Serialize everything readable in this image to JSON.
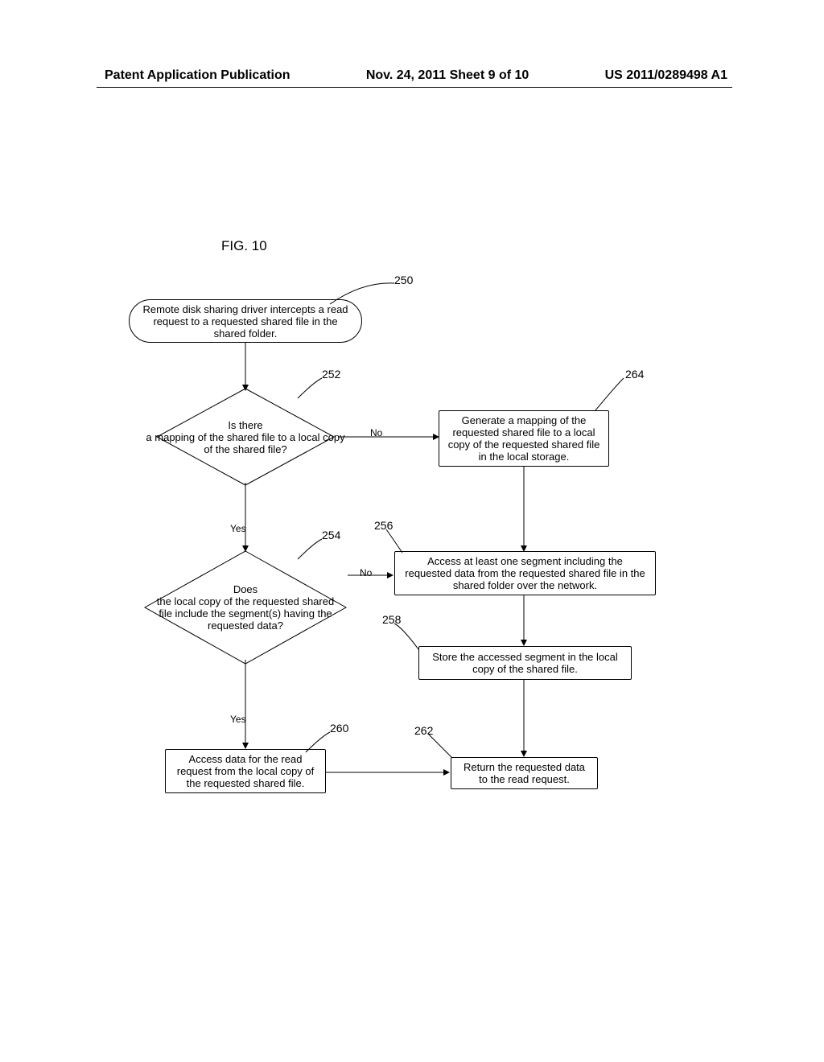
{
  "header": {
    "left": "Patent Application Publication",
    "center": "Nov. 24, 2011  Sheet 9 of 10",
    "right": "US 2011/0289498 A1"
  },
  "figureTitle": "FIG. 10",
  "refs": {
    "r250": "250",
    "r252": "252",
    "r254": "254",
    "r256": "256",
    "r258": "258",
    "r260": "260",
    "r262": "262",
    "r264": "264"
  },
  "nodes": {
    "n250": "Remote disk sharing driver intercepts a read request to a requested shared file in the shared folder.",
    "n252": "Is there\na mapping of the shared file to a local copy of the shared file?",
    "n254": "Does\nthe local copy of the requested shared file include the segment(s) having the requested data?",
    "n256": "Access at least one segment including the requested data from the requested shared file in the shared folder over the network.",
    "n258": "Store the accessed segment in the local copy of the shared file.",
    "n260": "Access data for the read request from the local copy of the requested shared file.",
    "n262": "Return the requested data to the read request.",
    "n264": "Generate a mapping of the requested shared file to a local copy of the requested shared file in the local storage."
  },
  "labels": {
    "yes": "Yes",
    "no": "No"
  }
}
